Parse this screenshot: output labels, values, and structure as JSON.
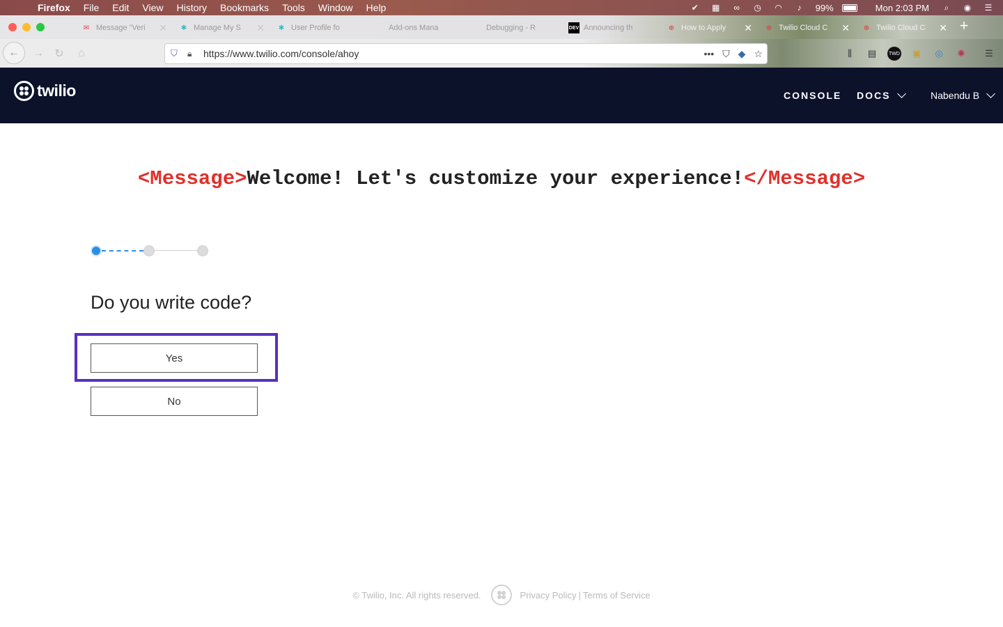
{
  "menubar": {
    "app_name": "Firefox",
    "items": [
      "File",
      "Edit",
      "View",
      "History",
      "Bookmarks",
      "Tools",
      "Window",
      "Help"
    ],
    "battery": "99%",
    "clock": "Mon 2:03 PM"
  },
  "tabs": [
    {
      "title": "Message \"Veri",
      "icon": "gmail-icon"
    },
    {
      "title": "Manage My S",
      "icon": "twilio-apps-icon"
    },
    {
      "title": "User Profile fo",
      "icon": "twilio-apps-icon"
    },
    {
      "title": "Add-ons Mana",
      "icon": ""
    },
    {
      "title": "Debugging - R",
      "icon": ""
    },
    {
      "title": "Announcing th",
      "icon": "dev-icon",
      "icon_text": "DEV"
    },
    {
      "title": "How to Apply",
      "icon": "twilio-icon"
    },
    {
      "title": "Twilio Cloud C",
      "icon": "twilio-icon"
    },
    {
      "title": "Twilio Cloud C",
      "icon": "twilio-icon"
    }
  ],
  "navbar": {
    "url": "https://www.twilio.com/console/ahoy"
  },
  "header": {
    "logo_text": "twilio",
    "nav_console": "CONSOLE",
    "nav_docs": "DOCS",
    "user_name": "Nabendu B"
  },
  "main": {
    "welcome_open_tag": "<Message>",
    "welcome_text": "Welcome! Let's customize your experience!",
    "welcome_close_tag": "</Message>",
    "question": "Do you write code?",
    "yes_label": "Yes",
    "no_label": "No",
    "steps_total": 3,
    "current_step": 1
  },
  "footer": {
    "copyright": "© Twilio, Inc. All rights reserved.",
    "privacy": "Privacy Policy",
    "separator": "|",
    "terms": "Terms of Service"
  },
  "colors": {
    "header_bg": "#0d122b",
    "tag_red": "#e0302a",
    "step_blue": "#2b8ee6",
    "highlight_purple": "#5a2fbd"
  }
}
